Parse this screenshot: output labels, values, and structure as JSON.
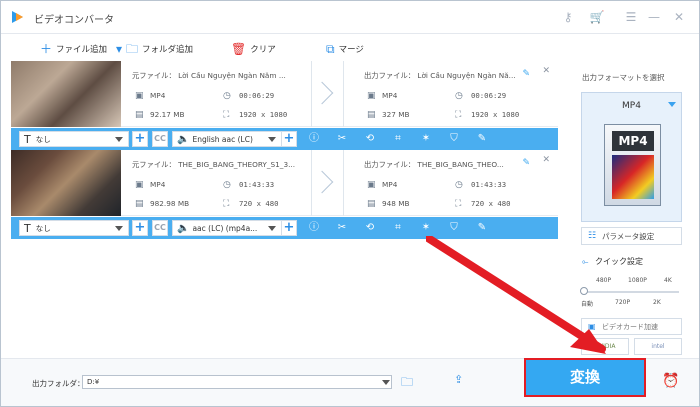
{
  "window": {
    "title": "ビデオコンバータ"
  },
  "toolbar": {
    "add_file": "ファイル追加",
    "add_folder": "フォルダ追加",
    "clear": "クリア",
    "merge": "マージ"
  },
  "files": [
    {
      "source_label": "元ファイル： Lời Cầu Nguyện Ngàn Năm ...",
      "source_format": "MP4",
      "source_duration": "00:06:29",
      "source_size": "92.17 MB",
      "source_resolution": "1920 x 1080",
      "output_label": "出力ファイル： Lời Cầu Nguyện Ngàn Nă...",
      "output_format": "MP4",
      "output_duration": "00:06:29",
      "output_size": "327 MB",
      "output_resolution": "1920 x 1080",
      "subtitle": "なし",
      "audio": "English aac (LC)"
    },
    {
      "source_label": "元ファイル： THE_BIG_BANG_THEORY_S1_3...",
      "source_format": "MP4",
      "source_duration": "01:43:33",
      "source_size": "982.98 MB",
      "source_resolution": "720 x 480",
      "output_label": "出力ファイル： THE_BIG_BANG_THEO...",
      "output_format": "MP4",
      "output_duration": "01:43:33",
      "output_size": "948 MB",
      "output_resolution": "720 x 480",
      "subtitle": "なし",
      "audio": "aac (LC) (mp4a..."
    }
  ],
  "right_panel": {
    "output_format_label": "出力フォーマットを選択",
    "format": "MP4",
    "format_icon_text": "MP4",
    "param_button": "パラメータ設定",
    "quick_settings": "クイック設定",
    "quality_top": [
      "480P",
      "1080P",
      "4K"
    ],
    "quality_bottom": [
      "自動",
      "720P",
      "2K"
    ],
    "gpu_button": "ビデオカード加速",
    "gpu_chips": [
      "NVIDIA",
      "intel"
    ]
  },
  "footer": {
    "output_folder_label": "出力フォルダ：",
    "output_folder_value": "D:¥",
    "convert_label": "変換"
  },
  "colors": {
    "accent": "#4aaef0",
    "accent_dark": "#2d8ee5",
    "highlight": "#e31d24"
  }
}
